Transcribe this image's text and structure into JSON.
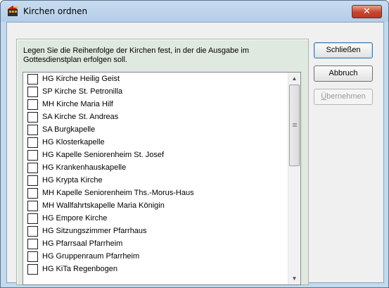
{
  "window": {
    "title": "Kirchen ordnen",
    "close_glyph": "✕"
  },
  "instruction": "Legen Sie die Reihenfolge der Kirchen fest, in der die Ausgabe im Gottesdienstplan erfolgen soll.",
  "churches": [
    {
      "label": "HG Kirche Heilig Geist",
      "checked": false
    },
    {
      "label": "SP Kirche St. Petronilla",
      "checked": false
    },
    {
      "label": "MH Kirche Maria Hilf",
      "checked": false
    },
    {
      "label": "SA Kirche St. Andreas",
      "checked": false
    },
    {
      "label": "SA Burgkapelle",
      "checked": false
    },
    {
      "label": "HG Klosterkapelle",
      "checked": false
    },
    {
      "label": "HG Kapelle Seniorenheim St. Josef",
      "checked": false
    },
    {
      "label": "HG Krankenhauskapelle",
      "checked": false
    },
    {
      "label": "HG Krypta Kirche",
      "checked": false
    },
    {
      "label": "MH Kapelle Seniorenheim Ths.-Morus-Haus",
      "checked": false
    },
    {
      "label": "MH Wallfahrtskapelle Maria Königin",
      "checked": false
    },
    {
      "label": "HG Empore Kirche",
      "checked": false
    },
    {
      "label": "HG Sitzungszimmer Pfarrhaus",
      "checked": false
    },
    {
      "label": "HG Pfarrsaal Pfarrheim",
      "checked": false
    },
    {
      "label": "HG Gruppenraum Pfarrheim",
      "checked": false
    },
    {
      "label": "HG KiTa Regenbogen",
      "checked": false
    }
  ],
  "buttons": {
    "close": "Schließen",
    "cancel": "Abbruch",
    "apply_first": "Ü",
    "apply_rest": "bernehmen"
  },
  "scrollbar": {
    "up_glyph": "▲",
    "down_glyph": "▼"
  }
}
